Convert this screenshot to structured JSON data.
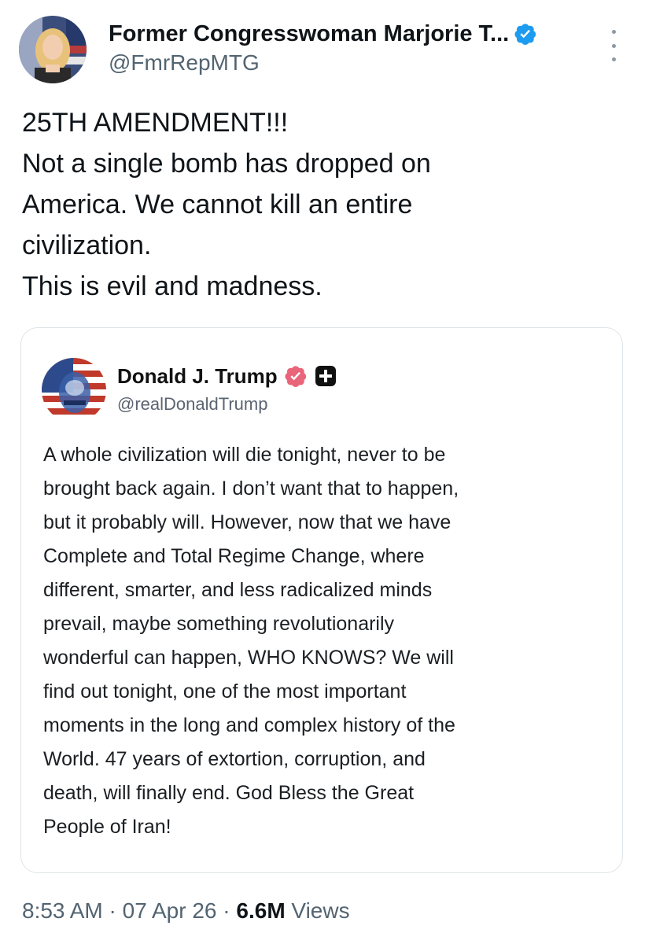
{
  "author": {
    "display_name": "Former Congresswoman Marjorie T...",
    "handle": "@FmrRepMTG",
    "verified_color": "#1d9bf0"
  },
  "tweet": {
    "lines": [
      "25TH AMENDMENT!!!",
      "Not a single bomb has dropped on",
      "America. We cannot kill an entire",
      "civilization.",
      "This is evil and madness."
    ]
  },
  "quoted_post": {
    "display_name": "Donald J. Trump",
    "handle": "@realDonaldTrump",
    "badge_color": "#e8657a",
    "lines": [
      "A whole civilization will die tonight, never to be",
      "brought back again. I don’t want that to happen,",
      "but it probably will. However, now that we have",
      "Complete and Total Regime Change, where",
      "different, smarter, and less radicalized minds",
      "prevail, maybe something revolutionarily",
      "wonderful can happen, WHO KNOWS? We will",
      "find out tonight, one of the most important",
      "moments in the long and complex history of the",
      "World. 47 years of extortion, corruption, and",
      "death, will finally end. God Bless the Great",
      "People of Iran!"
    ]
  },
  "meta": {
    "time": "8:53 AM",
    "separator": " · ",
    "date": "07 Apr 26",
    "views_count": "6.6M",
    "views_label": " Views"
  },
  "icons": {
    "verified": "verified-badge-icon",
    "more": "more-options-icon",
    "plus": "plus-badge-icon"
  }
}
